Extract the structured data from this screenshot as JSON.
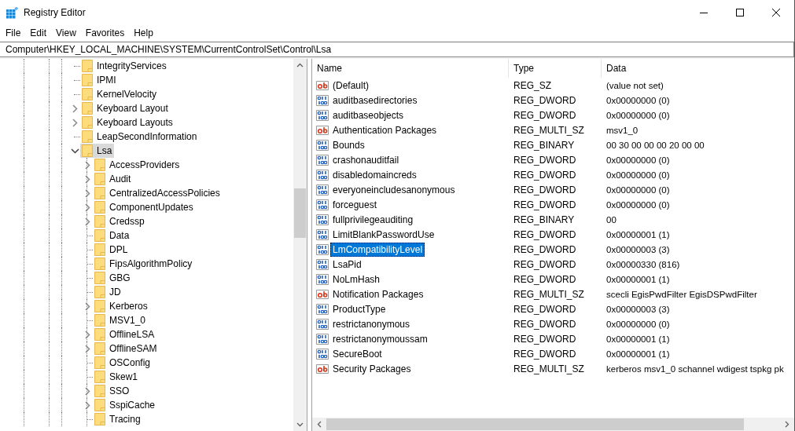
{
  "window": {
    "title": "Registry Editor"
  },
  "menu": [
    {
      "label": "File"
    },
    {
      "label": "Edit"
    },
    {
      "label": "View"
    },
    {
      "label": "Favorites"
    },
    {
      "label": "Help"
    }
  ],
  "address": {
    "value": "Computer\\HKEY_LOCAL_MACHINE\\SYSTEM\\CurrentControlSet\\Control\\Lsa"
  },
  "tree": {
    "items": [
      {
        "label": "IntegrityServices",
        "expandable": false,
        "selected": false
      },
      {
        "label": "IPMI",
        "expandable": false,
        "selected": false
      },
      {
        "label": "KernelVelocity",
        "expandable": false,
        "selected": false
      },
      {
        "label": "Keyboard Layout",
        "expandable": true,
        "expanded": false,
        "selected": false
      },
      {
        "label": "Keyboard Layouts",
        "expandable": true,
        "expanded": false,
        "selected": false
      },
      {
        "label": "LeapSecondInformation",
        "expandable": false,
        "selected": false
      },
      {
        "label": "Lsa",
        "expandable": true,
        "expanded": true,
        "selected": true,
        "children": [
          {
            "label": "AccessProviders",
            "expandable": true,
            "expanded": false,
            "selected": false
          },
          {
            "label": "Audit",
            "expandable": true,
            "expanded": false,
            "selected": false
          },
          {
            "label": "CentralizedAccessPolicies",
            "expandable": true,
            "expanded": false,
            "selected": false
          },
          {
            "label": "ComponentUpdates",
            "expandable": true,
            "expanded": false,
            "selected": false
          },
          {
            "label": "Credssp",
            "expandable": true,
            "expanded": false,
            "selected": false
          },
          {
            "label": "Data",
            "expandable": false,
            "selected": false
          },
          {
            "label": "DPL",
            "expandable": false,
            "selected": false
          },
          {
            "label": "FipsAlgorithmPolicy",
            "expandable": false,
            "selected": false
          },
          {
            "label": "GBG",
            "expandable": false,
            "selected": false
          },
          {
            "label": "JD",
            "expandable": false,
            "selected": false
          },
          {
            "label": "Kerberos",
            "expandable": true,
            "expanded": false,
            "selected": false
          },
          {
            "label": "MSV1_0",
            "expandable": false,
            "selected": false
          },
          {
            "label": "OfflineLSA",
            "expandable": true,
            "expanded": false,
            "selected": false
          },
          {
            "label": "OfflineSAM",
            "expandable": true,
            "expanded": false,
            "selected": false
          },
          {
            "label": "OSConfig",
            "expandable": false,
            "selected": false
          },
          {
            "label": "Skew1",
            "expandable": false,
            "selected": false
          },
          {
            "label": "SSO",
            "expandable": true,
            "expanded": false,
            "selected": false
          },
          {
            "label": "SspiCache",
            "expandable": true,
            "expanded": false,
            "selected": false
          },
          {
            "label": "Tracing",
            "expandable": false,
            "selected": false
          }
        ]
      }
    ]
  },
  "table": {
    "columns": [
      "Name",
      "Type",
      "Data"
    ],
    "rows": [
      {
        "kind": "string",
        "name": "(Default)",
        "type": "REG_SZ",
        "data": "(value not set)",
        "selected": false
      },
      {
        "kind": "binary",
        "name": "auditbasedirectories",
        "type": "REG_DWORD",
        "data": "0x00000000 (0)",
        "selected": false
      },
      {
        "kind": "binary",
        "name": "auditbaseobjects",
        "type": "REG_DWORD",
        "data": "0x00000000 (0)",
        "selected": false
      },
      {
        "kind": "string",
        "name": "Authentication Packages",
        "type": "REG_MULTI_SZ",
        "data": "msv1_0",
        "selected": false
      },
      {
        "kind": "binary",
        "name": "Bounds",
        "type": "REG_BINARY",
        "data": "00 30 00 00 00 20 00 00",
        "selected": false
      },
      {
        "kind": "binary",
        "name": "crashonauditfail",
        "type": "REG_DWORD",
        "data": "0x00000000 (0)",
        "selected": false
      },
      {
        "kind": "binary",
        "name": "disabledomaincreds",
        "type": "REG_DWORD",
        "data": "0x00000000 (0)",
        "selected": false
      },
      {
        "kind": "binary",
        "name": "everyoneincludesanonymous",
        "type": "REG_DWORD",
        "data": "0x00000000 (0)",
        "selected": false
      },
      {
        "kind": "binary",
        "name": "forceguest",
        "type": "REG_DWORD",
        "data": "0x00000000 (0)",
        "selected": false
      },
      {
        "kind": "binary",
        "name": "fullprivilegeauditing",
        "type": "REG_BINARY",
        "data": "00",
        "selected": false
      },
      {
        "kind": "binary",
        "name": "LimitBlankPasswordUse",
        "type": "REG_DWORD",
        "data": "0x00000001 (1)",
        "selected": false
      },
      {
        "kind": "binary",
        "name": "LmCompatibilityLevel",
        "type": "REG_DWORD",
        "data": "0x00000003 (3)",
        "selected": true
      },
      {
        "kind": "binary",
        "name": "LsaPid",
        "type": "REG_DWORD",
        "data": "0x00000330 (816)",
        "selected": false
      },
      {
        "kind": "binary",
        "name": "NoLmHash",
        "type": "REG_DWORD",
        "data": "0x00000001 (1)",
        "selected": false
      },
      {
        "kind": "string",
        "name": "Notification Packages",
        "type": "REG_MULTI_SZ",
        "data": "scecli EgisPwdFilter EgisDSPwdFilter",
        "selected": false
      },
      {
        "kind": "binary",
        "name": "ProductType",
        "type": "REG_DWORD",
        "data": "0x00000003 (3)",
        "selected": false
      },
      {
        "kind": "binary",
        "name": "restrictanonymous",
        "type": "REG_DWORD",
        "data": "0x00000000 (0)",
        "selected": false
      },
      {
        "kind": "binary",
        "name": "restrictanonymoussam",
        "type": "REG_DWORD",
        "data": "0x00000001 (1)",
        "selected": false
      },
      {
        "kind": "binary",
        "name": "SecureBoot",
        "type": "REG_DWORD",
        "data": "0x00000001 (1)",
        "selected": false
      },
      {
        "kind": "string",
        "name": "Security Packages",
        "type": "REG_MULTI_SZ",
        "data": "kerberos msv1_0 schannel wdigest tspkg pk",
        "selected": false
      }
    ]
  }
}
